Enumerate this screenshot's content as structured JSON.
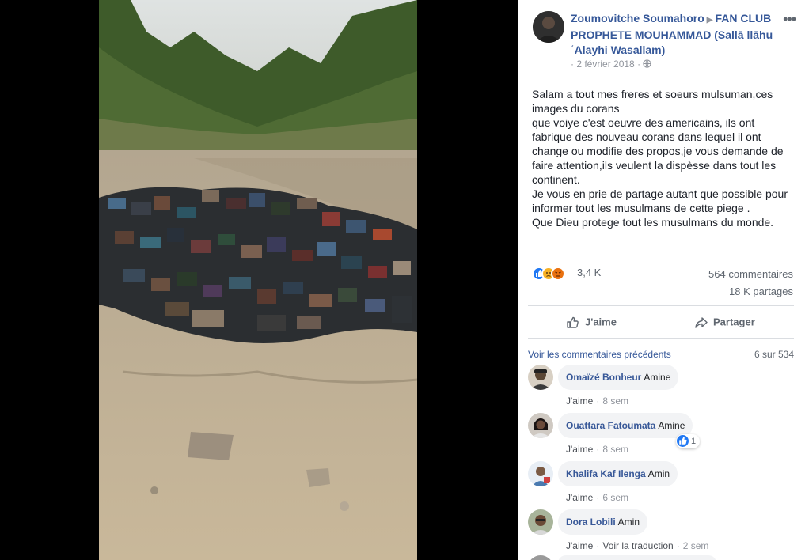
{
  "post": {
    "author": "Zoumovitche Soumahoro",
    "page": "FAN CLUB PROPHETE MOUHAMMAD (Sallā llāhu ʿAlayhi Wasallam)",
    "date": "2 février 2018",
    "text_lines": [
      "Salam a tout mes freres et soeurs mulsuman,ces images du corans",
      "que voiye c'est oeuvre des americains, ils ont fabrique des nouveau corans dans lequel il ont change ou modifie des propos,je vous demande de faire attention,ils veulent la dispèsse dans tout les continent.",
      "Je vous en prie de partage autant que possible pour informer tout les musulmans de cette piege .",
      "Que Dieu protege tout les musulmans du monde."
    ],
    "reactions_count": "3,4 K",
    "comments_count": "564 commentaires",
    "shares_count": "18 K partages"
  },
  "actions": {
    "like_label": "J'aime",
    "share_label": "Partager"
  },
  "comments_header": {
    "view_previous": "Voir les commentaires précédents",
    "pager": "6 sur 534"
  },
  "comments": [
    {
      "name": "Omaïzé Bonheur",
      "text": "Amine",
      "like": "J'aime",
      "time": "8 sem",
      "avatar_color": "#6b5a48"
    },
    {
      "name": "Ouattara Fatoumata",
      "text": "Amine",
      "like": "J'aime",
      "time": "8 sem",
      "reactions": "1",
      "avatar_color": "#3b2e2a"
    },
    {
      "name": "Khalifa Kaf Ilenga",
      "text": "Amin",
      "like": "J'aime",
      "time": "6 sem",
      "avatar_color": "#8a9bb0"
    },
    {
      "name": "Dora Lobili",
      "text": "Amin",
      "like": "J'aime",
      "translate": "Voir la traduction",
      "time": "2 sem",
      "avatar_color": "#7a8a70"
    }
  ],
  "icons": {
    "more": "more-options-icon",
    "globe": "globe-icon",
    "like": "thumbs-up-icon",
    "share": "share-arrow-icon"
  },
  "colors": {
    "link": "#365899",
    "like_blue": "#2078f4",
    "sad_yellow": "#f7b125",
    "angry_orange": "#e9710f"
  }
}
